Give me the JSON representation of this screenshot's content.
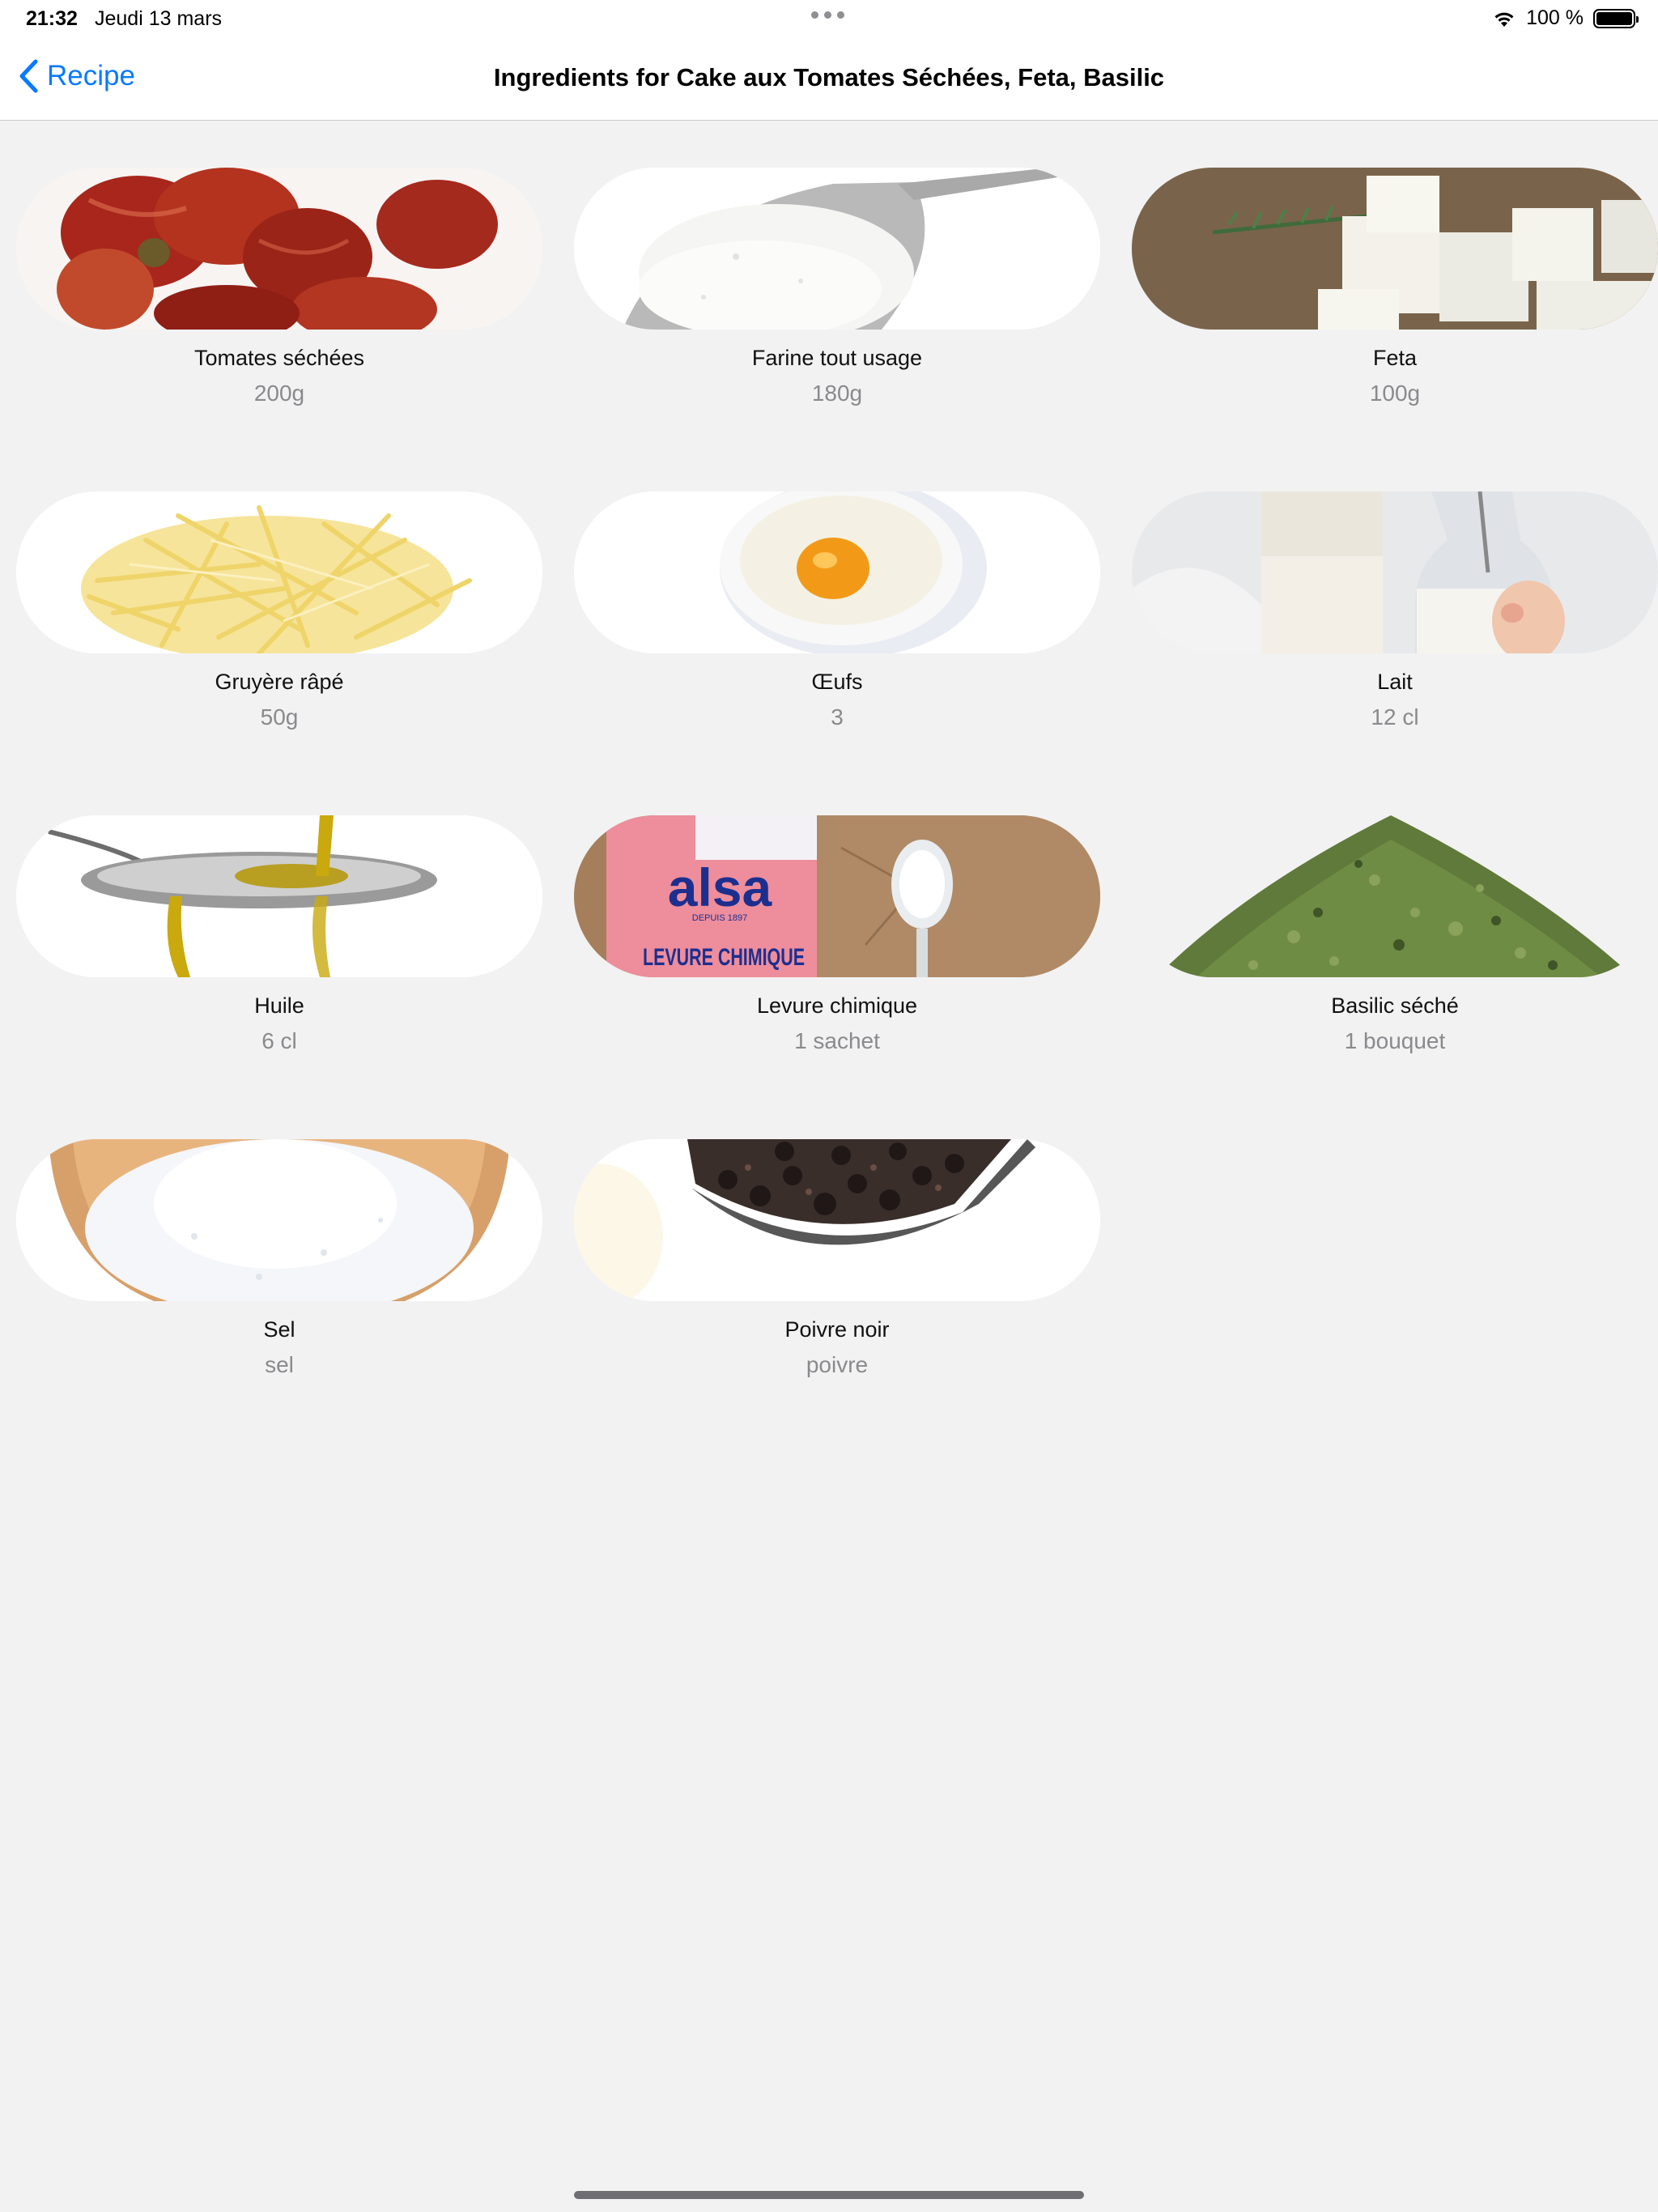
{
  "status_bar": {
    "time": "21:32",
    "date": "Jeudi 13 mars",
    "battery": "100 %"
  },
  "nav": {
    "back_label": "Recipe",
    "title": "Ingredients for Cake aux Tomates Séchées, Feta, Basilic"
  },
  "colors": {
    "accent": "#0a7aff",
    "background": "#f2f2f2",
    "secondary_text": "#8a8a8e"
  },
  "ingredients": [
    {
      "name": "Tomates séchées",
      "qty": "200g",
      "icon": "dried-tomatoes-image"
    },
    {
      "name": "Farine tout usage",
      "qty": "180g",
      "icon": "flour-scoop-image"
    },
    {
      "name": "Feta",
      "qty": "100g",
      "icon": "feta-cubes-image"
    },
    {
      "name": "Gruyère râpé",
      "qty": "50g",
      "icon": "grated-cheese-image"
    },
    {
      "name": "Œufs",
      "qty": "3",
      "icon": "egg-bowl-image"
    },
    {
      "name": "Lait",
      "qty": "12 cl",
      "icon": "milk-bottles-image"
    },
    {
      "name": "Huile",
      "qty": "6 cl",
      "icon": "oil-spoon-image"
    },
    {
      "name": "Levure chimique",
      "qty": "1 sachet",
      "icon": "baking-powder-image",
      "brand_text": "alsa",
      "pack_text": "LEVURE CHIMIQUE",
      "since_text": "DEPUIS 1897"
    },
    {
      "name": "Basilic séché",
      "qty": "1 bouquet",
      "icon": "dried-basil-image"
    },
    {
      "name": "Sel",
      "qty": "sel",
      "icon": "salt-bowl-image"
    },
    {
      "name": "Poivre noir",
      "qty": "poivre",
      "icon": "peppercorns-spoon-image"
    }
  ]
}
